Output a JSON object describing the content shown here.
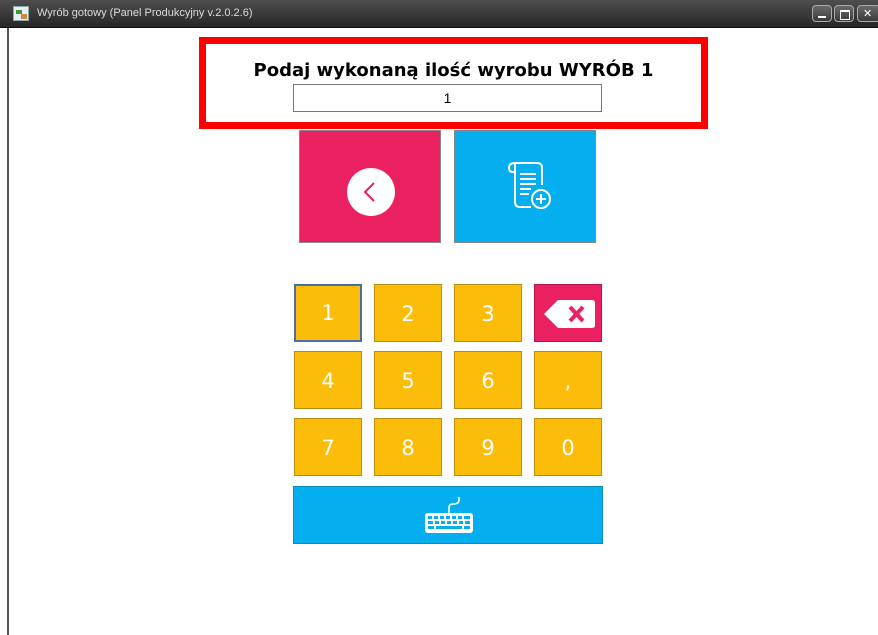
{
  "window": {
    "title": "Wyrób gotowy (Panel Produkcyjny v.2.0.2.6)",
    "controls": [
      "minimize",
      "maximize",
      "close"
    ],
    "close_glyph": "✕"
  },
  "prompt": {
    "text": "Podaj wykonaną ilość wyrobu WYRÓB 1",
    "quantity_value": "1"
  },
  "actions": {
    "back_icon": "chevron-left-icon",
    "add_document_icon": "document-add-icon"
  },
  "keypad": {
    "row1": [
      "1",
      "2",
      "3"
    ],
    "row2": [
      "4",
      "5",
      "6",
      ","
    ],
    "row3": [
      "7",
      "8",
      "9",
      "0"
    ],
    "backspace_icon": "backspace-icon",
    "keyboard_icon": "keyboard-icon"
  },
  "colors": {
    "highlight_border": "#ff0000",
    "back_button": "#eb2060",
    "blue_button": "#04aeef",
    "key": "#fcbc0a"
  }
}
